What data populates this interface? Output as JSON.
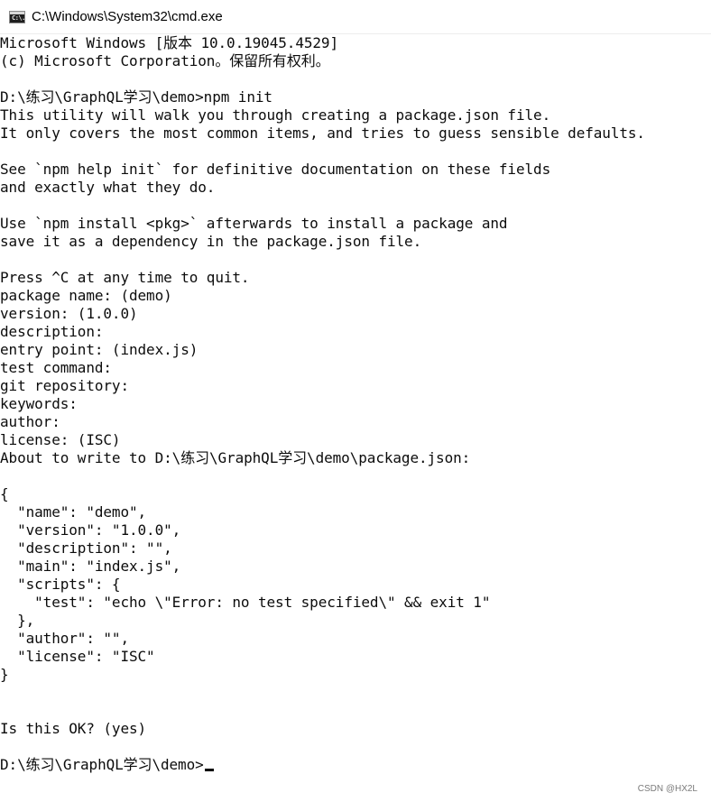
{
  "window": {
    "title": "C:\\Windows\\System32\\cmd.exe",
    "icon": "cmd-console-icon",
    "icon_glyph": "C:\\."
  },
  "console": {
    "lines": [
      "Microsoft Windows [版本 10.0.19045.4529]",
      "(c) Microsoft Corporation。保留所有权利。",
      "",
      "D:\\练习\\GraphQL学习\\demo>npm init",
      "This utility will walk you through creating a package.json file.",
      "It only covers the most common items, and tries to guess sensible defaults.",
      "",
      "See `npm help init` for definitive documentation on these fields",
      "and exactly what they do.",
      "",
      "Use `npm install <pkg>` afterwards to install a package and",
      "save it as a dependency in the package.json file.",
      "",
      "Press ^C at any time to quit.",
      "package name: (demo)",
      "version: (1.0.0)",
      "description:",
      "entry point: (index.js)",
      "test command:",
      "git repository:",
      "keywords:",
      "author:",
      "license: (ISC)",
      "About to write to D:\\练习\\GraphQL学习\\demo\\package.json:",
      "",
      "{",
      "  \"name\": \"demo\",",
      "  \"version\": \"1.0.0\",",
      "  \"description\": \"\",",
      "  \"main\": \"index.js\",",
      "  \"scripts\": {",
      "    \"test\": \"echo \\\"Error: no test specified\\\" && exit 1\"",
      "  },",
      "  \"author\": \"\",",
      "  \"license\": \"ISC\"",
      "}",
      "",
      "",
      "Is this OK? (yes)",
      "",
      "D:\\练习\\GraphQL学习\\demo>"
    ],
    "cursor": "block-underline-cursor"
  },
  "watermark": {
    "text": "CSDN @HX2L"
  },
  "colors": {
    "background": "#ffffff",
    "text": "#0c0c0c"
  }
}
